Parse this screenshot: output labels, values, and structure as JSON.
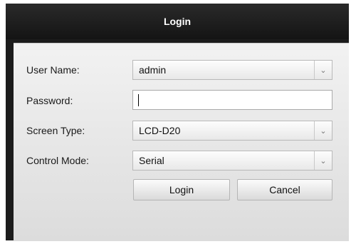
{
  "dialog": {
    "title": "Login"
  },
  "form": {
    "user_name": {
      "label": "User Name:",
      "value": "admin"
    },
    "password": {
      "label": "Password:",
      "value": ""
    },
    "screen_type": {
      "label": "Screen Type:",
      "value": "LCD-D20"
    },
    "control_mode": {
      "label": "Control Mode:",
      "value": "Serial"
    }
  },
  "buttons": {
    "login": "Login",
    "cancel": "Cancel"
  },
  "icons": {
    "dropdown": "chevron-down-icon"
  }
}
